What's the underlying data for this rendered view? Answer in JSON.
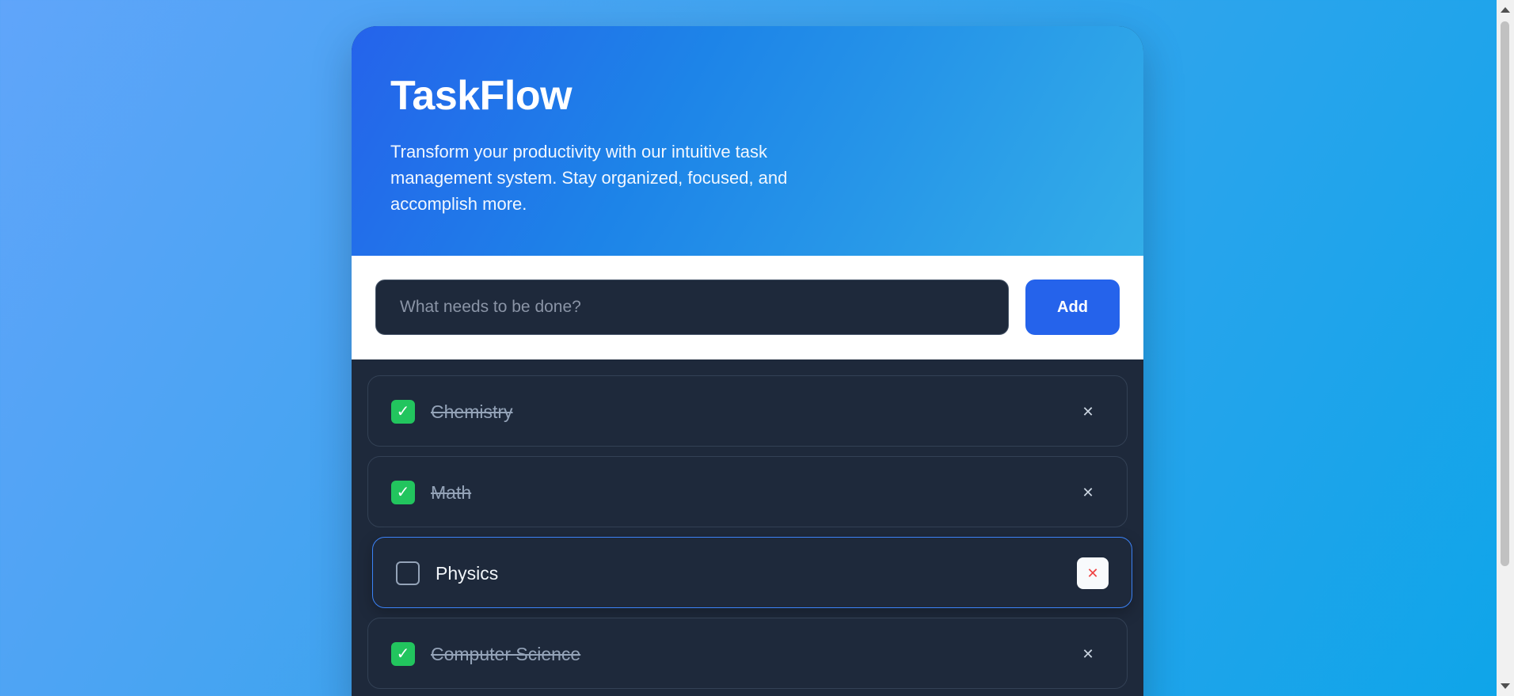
{
  "header": {
    "title": "TaskFlow",
    "subtitle": "Transform your productivity with our intuitive task management system. Stay organized, focused, and accomplish more."
  },
  "input": {
    "placeholder": "What needs to be done?",
    "value": "",
    "add_label": "Add"
  },
  "tasks": [
    {
      "label": "Chemistry",
      "completed": true,
      "checkmark": "✓",
      "delete_glyph": "✕"
    },
    {
      "label": "Math",
      "completed": true,
      "checkmark": "✓",
      "delete_glyph": "✕"
    },
    {
      "label": "Physics",
      "completed": false,
      "checkmark": "",
      "delete_glyph": "✕"
    },
    {
      "label": "Computer Science",
      "completed": true,
      "checkmark": "✓",
      "delete_glyph": "✕"
    }
  ],
  "colors": {
    "accent": "#2563eb",
    "done": "#22c55e",
    "danger": "#ef4444",
    "surface": "#1e293b"
  }
}
